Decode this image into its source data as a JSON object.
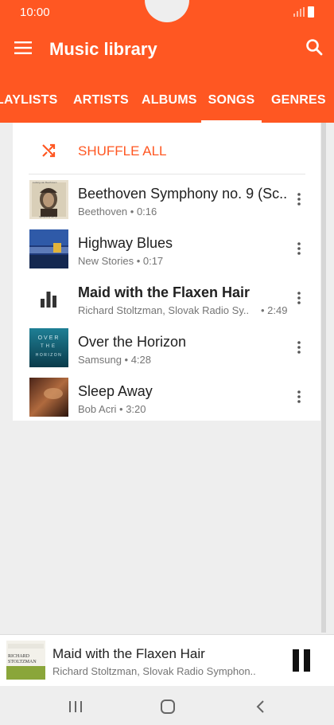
{
  "status_bar": {
    "time": "10:00",
    "icons": [
      "signal-icon",
      "battery-icon"
    ]
  },
  "app_bar": {
    "title": "Music library",
    "menu_icon": "hamburger-menu-icon",
    "search_icon": "search-icon"
  },
  "tabs": [
    {
      "label": "LAYLISTS",
      "active": false
    },
    {
      "label": "ARTISTS",
      "active": false
    },
    {
      "label": "ALBUMS",
      "active": false
    },
    {
      "label": "SONGS",
      "active": true
    },
    {
      "label": "GENRES",
      "active": false
    }
  ],
  "shuffle": {
    "label": "SHUFFLE ALL",
    "icon": "shuffle-icon"
  },
  "songs": [
    {
      "title": "Beethoven Symphony no. 9 (Sc..",
      "subtitle": "Beethoven • 0:16",
      "playing": false
    },
    {
      "title": "Highway Blues",
      "subtitle": "New Stories • 0:17",
      "playing": false
    },
    {
      "title": "Maid with the Flaxen Hair",
      "subtitle": "Richard Stoltzman, Slovak Radio Sy..",
      "duration": "• 2:49",
      "playing": true
    },
    {
      "title": "Over the Horizon",
      "subtitle": "Samsung • 4:28",
      "playing": false
    },
    {
      "title": "Sleep Away",
      "subtitle": "Bob Acri • 3:20",
      "playing": false
    }
  ],
  "album_art_text": {
    "beethoven": [
      "Ludwig van Beethoven",
      "Symphony No. 9"
    ],
    "horizon": [
      "OVER",
      "THE",
      "HORIZON"
    ],
    "stoltzman": [
      "RICHARD",
      "STOLTZMAN"
    ]
  },
  "now_playing": {
    "title": "Maid with the Flaxen Hair",
    "subtitle": "Richard Stoltzman, Slovak Radio Symphon..",
    "control_icon": "pause-icon"
  },
  "nav_bar": [
    "recent-apps-icon",
    "home-icon",
    "back-icon"
  ],
  "colors": {
    "accent": "#ff5722",
    "background": "#eeeeee",
    "card": "#ffffff"
  }
}
